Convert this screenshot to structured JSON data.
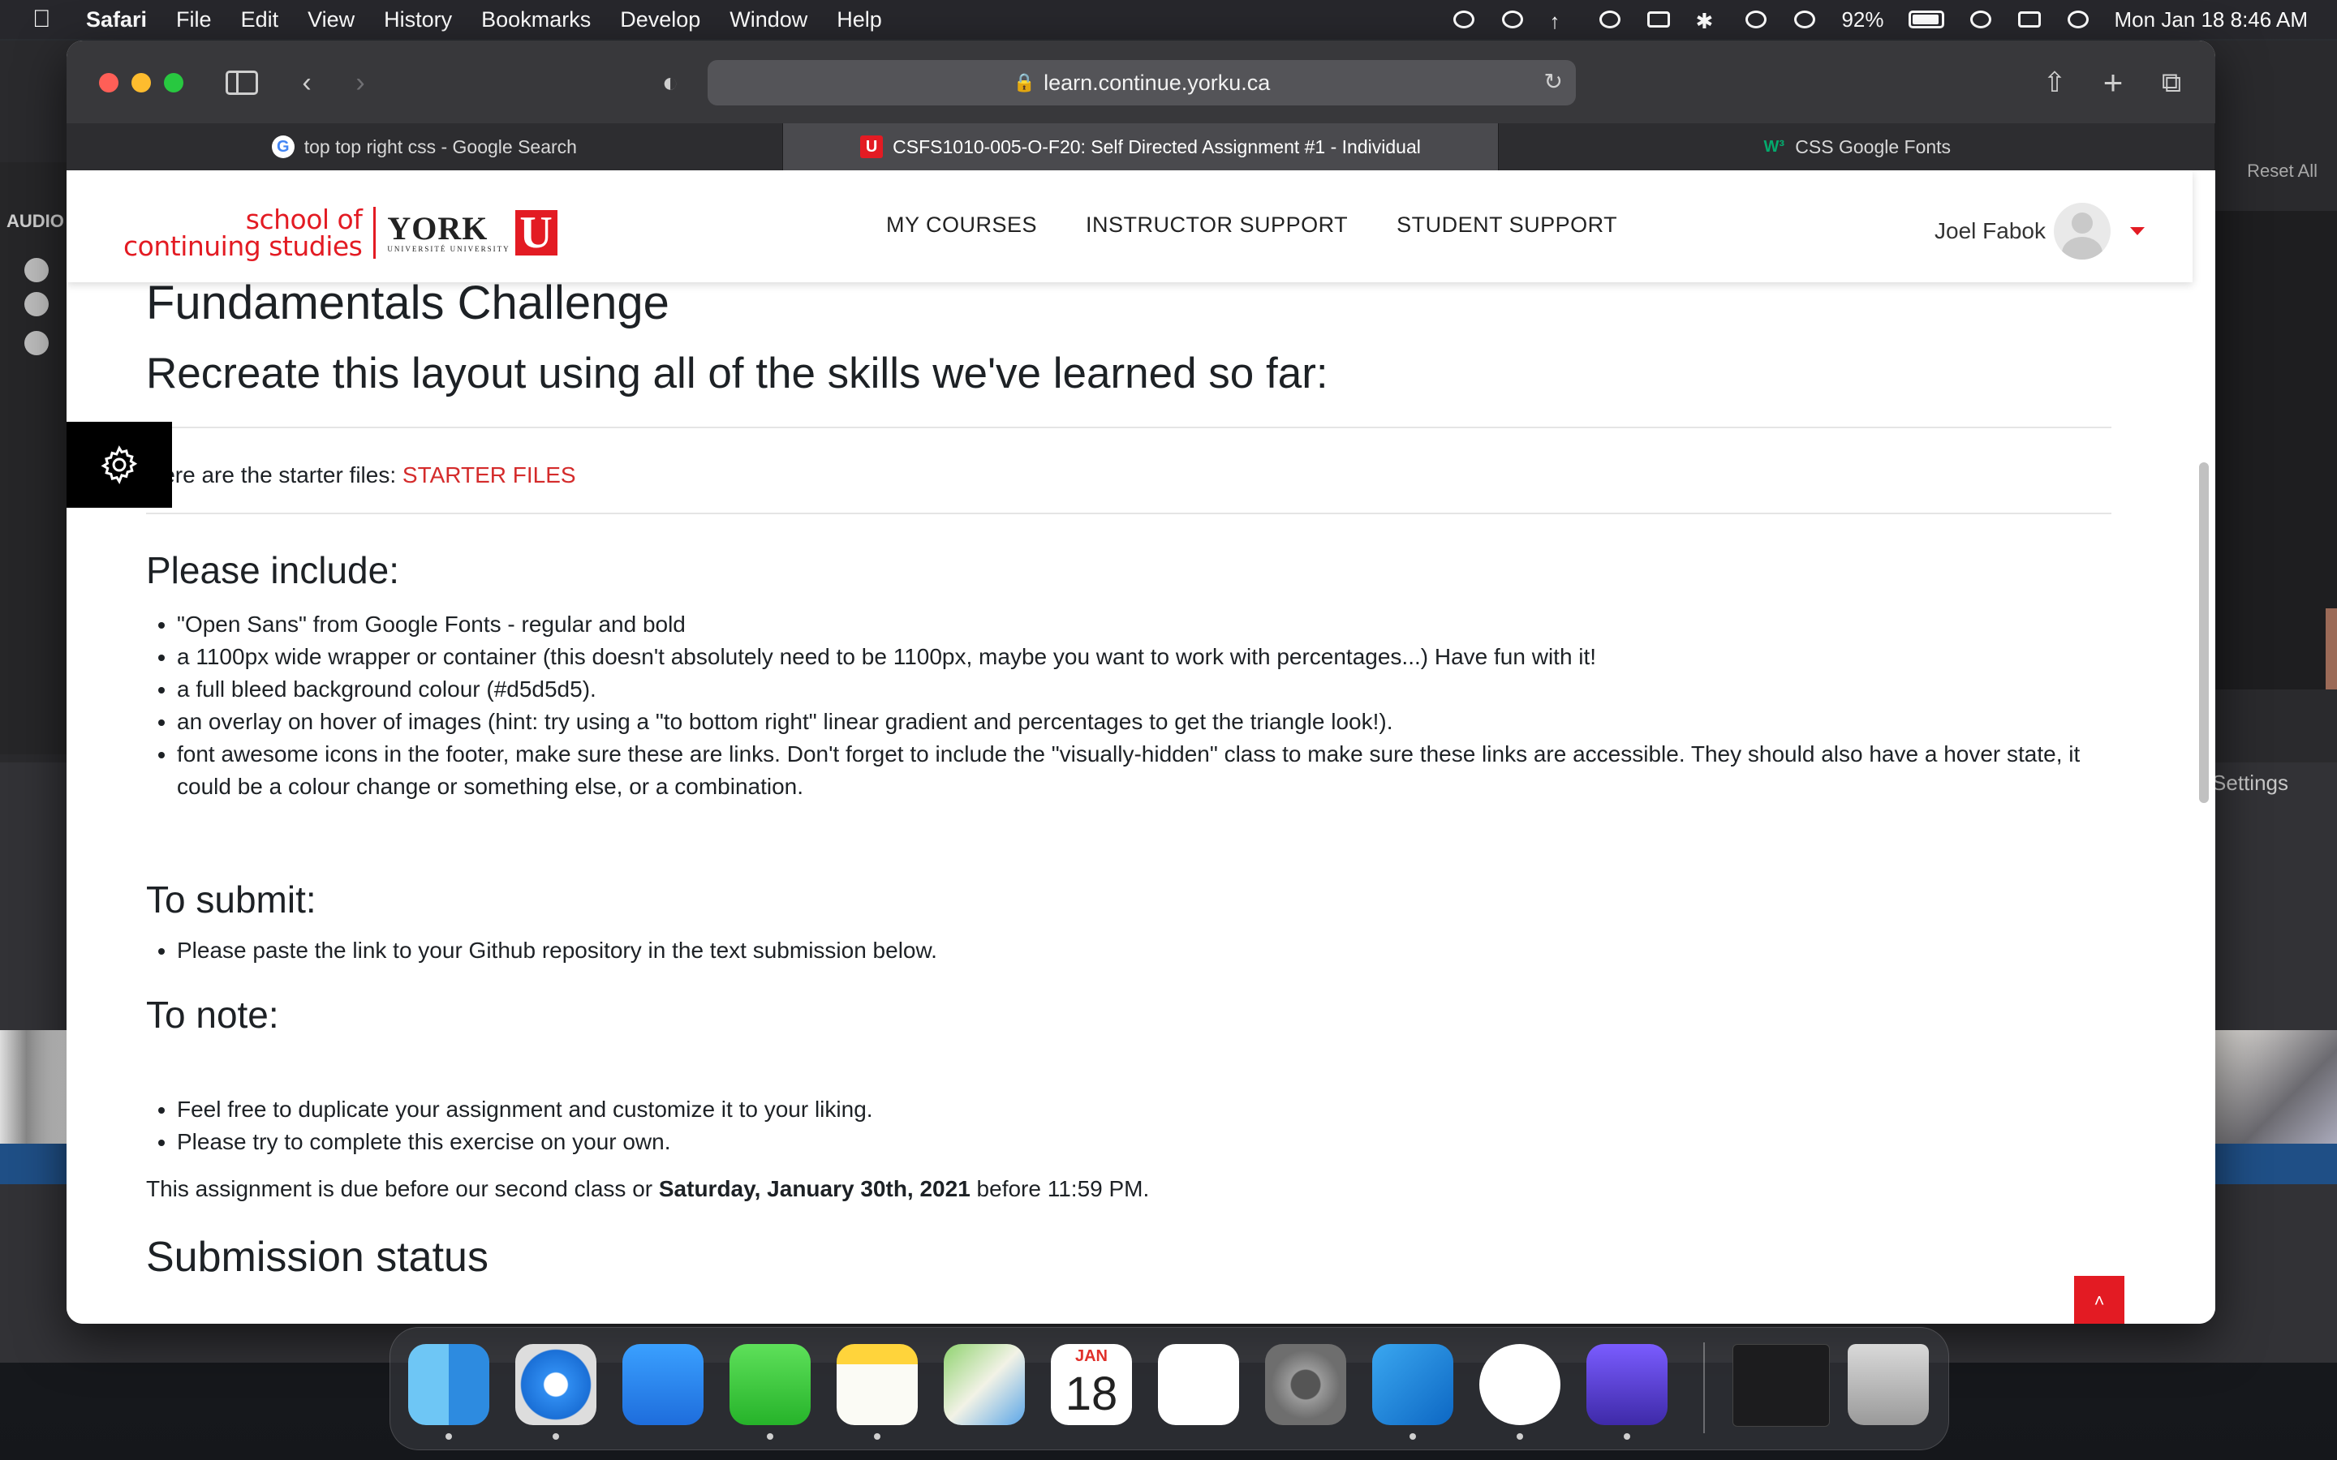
{
  "menubar": {
    "app": "Safari",
    "items": [
      "File",
      "Edit",
      "View",
      "History",
      "Bookmarks",
      "Develop",
      "Window",
      "Help"
    ],
    "battery": "92%",
    "datetime": "Mon Jan 18  8:46 AM"
  },
  "background_app": {
    "audio_label": "AUDIO",
    "reset_label": "Reset All",
    "settings_label": "Settings"
  },
  "browser": {
    "url": "learn.continue.yorku.ca",
    "tabs": [
      {
        "label": "top top right css - Google Search",
        "favicon": "google-icon"
      },
      {
        "label": "CSFS1010-005-O-F20: Self Directed Assignment #1 - Individual",
        "favicon": "york-u-icon"
      },
      {
        "label": "CSS Google Fonts",
        "favicon": "w3schools-icon"
      }
    ]
  },
  "site": {
    "logo_line1": "school of",
    "logo_line2": "continuing studies",
    "logo_york": "YORK",
    "logo_univ": "UNIVERSITÉ UNIVERSITY",
    "logo_u": "U",
    "nav": [
      "MY COURSES",
      "INSTRUCTOR SUPPORT",
      "STUDENT SUPPORT"
    ],
    "user_name": "Joel Fabok",
    "accent": "#e31b23"
  },
  "content": {
    "title": "Fundamentals Challenge",
    "subtitle": "Recreate this layout using all of the skills we've learned so far:",
    "starter_prefix": "Here are the starter files: ",
    "starter_link": "STARTER FILES",
    "include_heading": "Please include:",
    "include_items": [
      "\"Open Sans\" from Google Fonts - regular and bold",
      "a 1100px wide wrapper or container (this doesn't absolutely need to be 1100px, maybe you want to work with percentages...) Have fun with it!",
      "a full bleed background colour (#d5d5d5).",
      "an overlay on hover of images (hint: try using a \"to bottom right\" linear gradient and percentages to get the triangle look!).",
      "font awesome icons in the footer, make sure these are links. Don't forget to include the \"visually-hidden\" class to make sure these links are accessible. They should also have a hover state, it could be a colour change or something else, or a combination."
    ],
    "submit_heading": "To submit:",
    "submit_items": [
      "Please paste the link to your Github repository in the text submission below."
    ],
    "note_heading": "To note:",
    "note_items": [
      "Feel free to duplicate your assignment and customize it to your liking.",
      "Please try to complete this exercise on your own."
    ],
    "due_prefix": "This assignment is due before our second class or ",
    "due_date": "Saturday, January 30th, 2021",
    "due_suffix": " before 11:59 PM.",
    "status_heading": "Submission status"
  },
  "dock": {
    "apps": [
      "finder-icon",
      "safari-icon",
      "mail-icon",
      "messages-icon",
      "notes-icon",
      "maps-icon",
      "calendar-icon",
      "reminders-icon",
      "system-preferences-icon",
      "vscode-icon",
      "slack-icon",
      "imovie-icon",
      "vscode-window-icon",
      "trash-icon"
    ],
    "calendar_month": "JAN",
    "calendar_day": "18"
  }
}
